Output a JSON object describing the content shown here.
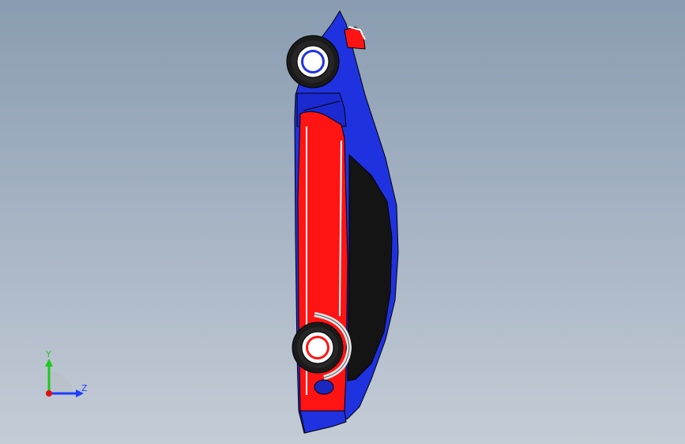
{
  "viewport": {
    "background_top": "#8a9cb1",
    "background_bottom": "#c4ccd6"
  },
  "model": {
    "body_color": "#1f32e0",
    "accent_color": "#ff1414",
    "window_color": "#141414",
    "tire_color": "#1a1a1a",
    "rim_color": "#ffffff"
  },
  "triad": {
    "y_label": "Y",
    "z_label": "Z",
    "y_color": "#1ec81e",
    "z_color": "#1e3cff",
    "x_color": "#e01010"
  }
}
